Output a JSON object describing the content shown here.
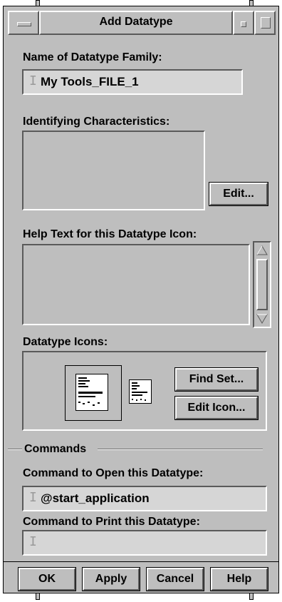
{
  "window": {
    "title": "Add Datatype"
  },
  "name_section": {
    "label": "Name of Datatype Family:",
    "value": "My Tools_FILE_1"
  },
  "characteristics": {
    "label": "Identifying Characteristics:",
    "edit_button": "Edit..."
  },
  "help_text": {
    "label": "Help Text for this Datatype Icon:"
  },
  "icons": {
    "label": "Datatype Icons:",
    "find_set_button": "Find Set...",
    "edit_icon_button": "Edit Icon..."
  },
  "commands": {
    "section_label": "Commands",
    "open_label": "Command to Open this Datatype:",
    "open_value": "@start_application",
    "print_label": "Command to Print this Datatype:",
    "print_value": ""
  },
  "footer": {
    "ok": "OK",
    "apply": "Apply",
    "cancel": "Cancel",
    "help": "Help"
  }
}
